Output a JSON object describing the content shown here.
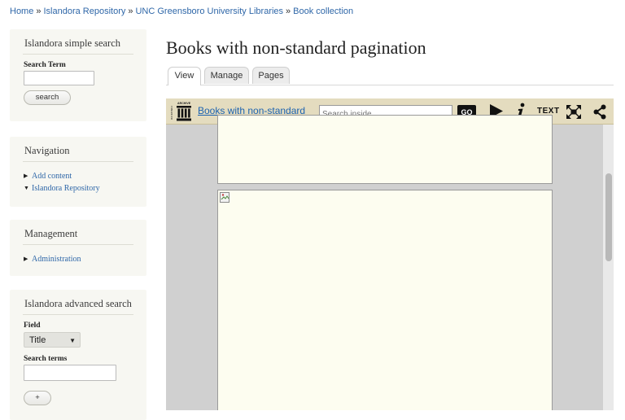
{
  "breadcrumb": {
    "items": [
      "Home",
      "Islandora Repository",
      "UNC Greensboro University Libraries",
      "Book collection"
    ],
    "separator": "»"
  },
  "sidebar": {
    "simple_search": {
      "title": "Islandora simple search",
      "field_label": "Search Term",
      "field_value": "",
      "button": "search"
    },
    "navigation": {
      "title": "Navigation",
      "items": [
        {
          "label": "Add content",
          "arrow": "right"
        },
        {
          "label": "Islandora Repository",
          "arrow": "down"
        }
      ]
    },
    "management": {
      "title": "Management",
      "items": [
        {
          "label": "Administration"
        }
      ]
    },
    "advanced_search": {
      "title": "Islandora advanced search",
      "field_label": "Field",
      "field_selected": "Title",
      "terms_label": "Search terms",
      "terms_value": "",
      "add_button": "+"
    }
  },
  "main": {
    "page_title": "Books with non-standard pagination",
    "tabs": [
      {
        "label": "View",
        "active": true
      },
      {
        "label": "Manage",
        "active": false
      },
      {
        "label": "Pages",
        "active": false
      }
    ]
  },
  "viewer": {
    "logo_caption": "INTERNET ARCHIVE",
    "book_title": "Books with non-standard",
    "search_placeholder": "Search inside",
    "go_label": "GO",
    "text_label": "TEXT",
    "icons": [
      "archive-logo-icon",
      "play-icon",
      "info-icon",
      "fullscreen-icon",
      "share-icon",
      "broken-image-icon"
    ]
  },
  "colors": {
    "link": "#2f67a8",
    "toolbar": "#e4dcbf",
    "page": "#fdfdf0",
    "sidebar_block": "#f7f7f2",
    "viewer_bg": "#d0d0d0"
  }
}
